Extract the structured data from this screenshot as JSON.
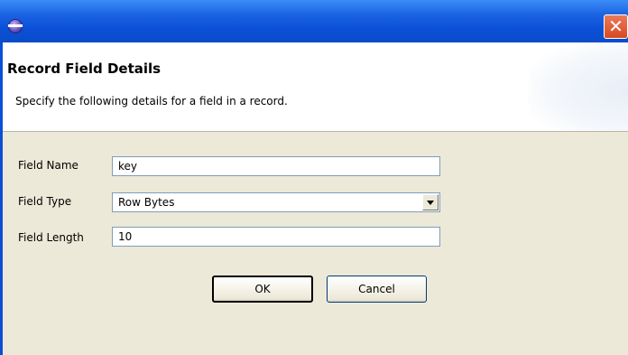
{
  "window": {
    "close_glyph": "✕"
  },
  "header": {
    "title": "Record Field Details",
    "description": "Specify the following details for a field in a record."
  },
  "form": {
    "field_name": {
      "label": "Field Name",
      "value": "key"
    },
    "field_type": {
      "label": "Field Type",
      "value": "Row Bytes"
    },
    "field_length": {
      "label": "Field Length",
      "value": "10"
    }
  },
  "buttons": {
    "ok_label": "OK",
    "cancel_label": "Cancel"
  },
  "colors": {
    "titlebar": "#0a4fd6",
    "dialog_bg": "#ece9d8",
    "close_button": "#d84a22"
  }
}
